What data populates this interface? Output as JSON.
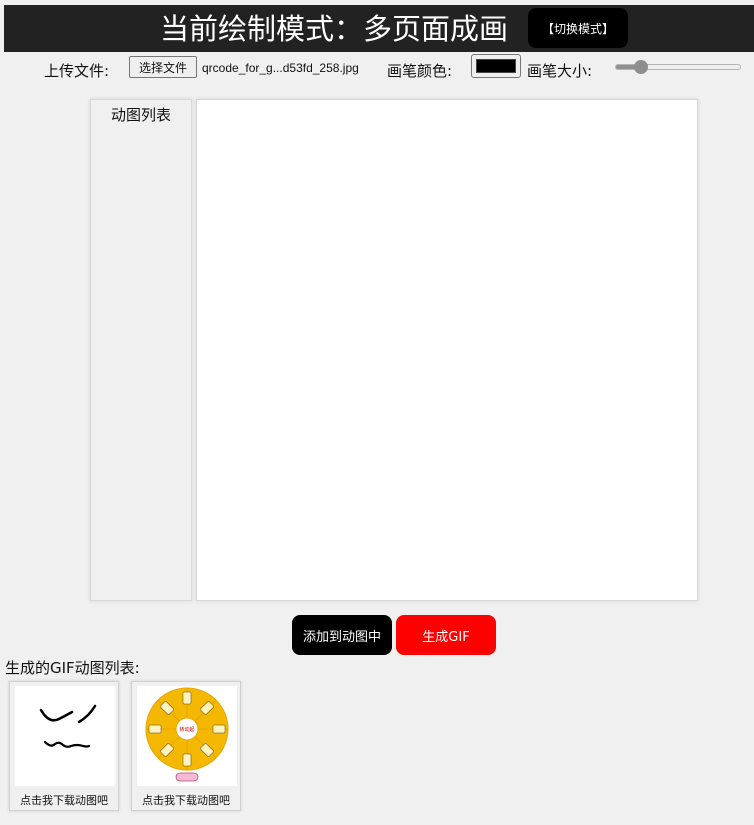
{
  "header": {
    "title": "当前绘制模式：多页面成画",
    "mode_button": "【切换模式】"
  },
  "toolbar": {
    "upload_label": "上传文件:",
    "file_button": "选择文件",
    "file_name": "qrcode_for_g...d53fd_258.jpg",
    "color_label": "画笔颜色:",
    "pen_color": "#000000",
    "size_label": "画笔大小:",
    "pen_size_fraction": 0.2
  },
  "left_panel": {
    "title": "动图列表"
  },
  "actions": {
    "add_button": "添加到动图中",
    "generate_button": "生成GIF"
  },
  "gif_list": {
    "title": "生成的GIF动图列表:",
    "items": [
      {
        "caption": "点击我下载动图吧",
        "thumbnail": "hand-drawn-face"
      },
      {
        "caption": "点击我下载动图吧",
        "thumbnail": "prize-wheel",
        "wheel_center_text": "转动起"
      }
    ]
  },
  "colors": {
    "header_bg": "#222222",
    "accent_red": "#ff0000",
    "button_black": "#000000",
    "wheel_yellow": "#f5b800"
  }
}
